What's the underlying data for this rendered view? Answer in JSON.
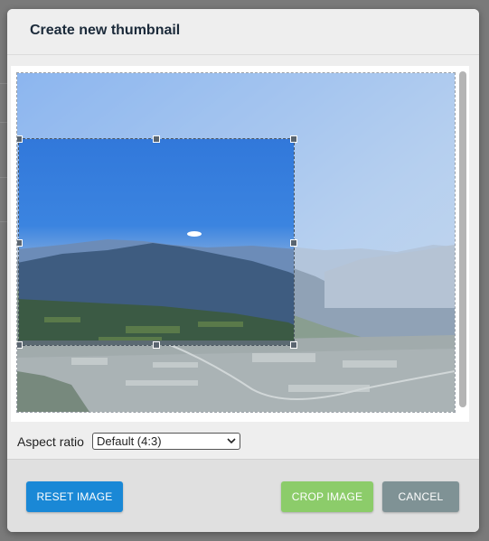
{
  "dialog": {
    "title": "Create new thumbnail"
  },
  "cropper": {
    "image_description_icon": "landscape-photo"
  },
  "aspect_ratio": {
    "label": "Aspect ratio",
    "selected": "Default (4:3)"
  },
  "footer": {
    "reset_label": "RESET IMAGE",
    "crop_label": "CROP IMAGE",
    "cancel_label": "CANCEL"
  },
  "colors": {
    "reset_button": "#1a88d6",
    "crop_button": "#8ccc6a",
    "cancel_button": "#7f9295"
  }
}
